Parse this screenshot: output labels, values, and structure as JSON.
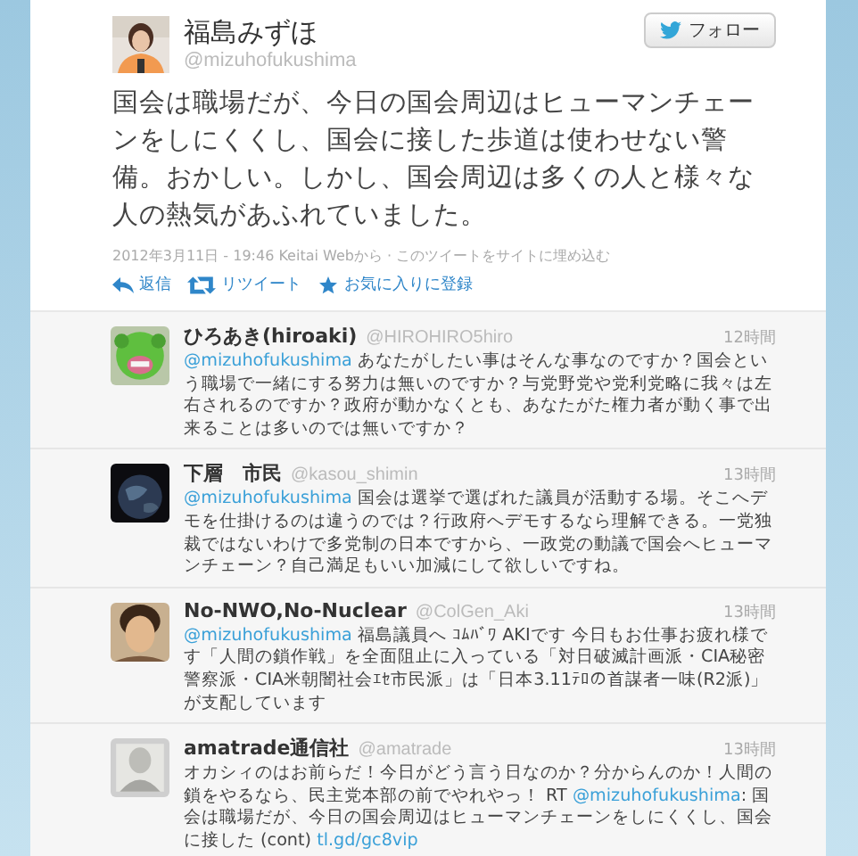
{
  "tweet": {
    "name": "福島みずほ",
    "handle": "@mizuhofukushima",
    "follow_button": "フォロー",
    "text": "国会は職場だが、今日の国会周辺はヒューマンチェーンをしにくくし、国会に接した歩道は使わせない警備。おかしい。しかし、国会周辺は多くの人と様々な人の熱気があふれていました。",
    "meta": "2012年3月11日 - 19:46 Keitai Webから · このツイートをサイトに埋め込む",
    "actions": [
      {
        "kind": "reply",
        "label": "返信"
      },
      {
        "kind": "retweet",
        "label": "リツイート"
      },
      {
        "kind": "favorite",
        "label": "お気に入りに登録"
      }
    ]
  },
  "replies": [
    {
      "name": "ひろあき(hiroaki)",
      "handle": "@HIROHIRO5hiro",
      "time": "12時間",
      "parts": [
        {
          "kind": "link",
          "text": "@mizuhofukushima"
        },
        {
          "kind": "text",
          "text": " あなたがしたい事はそんな事なのですか？国会という職場で一緒にする努力は無いのですか？与党野党や党利党略に我々は左右されるのですか？政府が動かなくとも、あなたがた権力者が動く事で出来ることは多いのでは無いですか？"
        }
      ]
    },
    {
      "name": "下層　市民",
      "handle": "@kasou_shimin",
      "time": "13時間",
      "parts": [
        {
          "kind": "link",
          "text": "@mizuhofukushima"
        },
        {
          "kind": "text",
          "text": " 国会は選挙で選ばれた議員が活動する場。そこへデモを仕掛けるのは違うのでは？行政府へデモするなら理解できる。一党独裁ではないわけで多党制の日本ですから、一政党の動議で国会へヒューマンチェーン？自己満足もいい加減にして欲しいですね。"
        }
      ]
    },
    {
      "name": "No-NWO,No-Nuclear",
      "handle": "@ColGen_Aki",
      "time": "13時間",
      "parts": [
        {
          "kind": "link",
          "text": "@mizuhofukushima"
        },
        {
          "kind": "text",
          "text": " 福島議員へ ｺﾑﾊﾞﾜ AKIです 今日もお仕事お疲れ様です「人間の鎖作戦」を全面阻止に入っている「対日破滅計画派・CIA秘密警察派・CIA米朝闇社会ｴｾ市民派」は「日本3.11ﾃﾛの首謀者一味(R2派)」が支配しています"
        }
      ]
    },
    {
      "name": "amatrade通信社",
      "handle": "@amatrade",
      "time": "13時間",
      "parts": [
        {
          "kind": "text",
          "text": "オカシィのはお前らだ！今日がどう言う日なのか？分からんのか！人間の鎖をやるなら、民主党本部の前でやれやっ！ RT "
        },
        {
          "kind": "link",
          "text": "@mizuhofukushima"
        },
        {
          "kind": "text",
          "text": ": 国会は職場だが、今日の国会周辺はヒューマンチェーンをしにくくし、国会に接した (cont) "
        },
        {
          "kind": "link",
          "text": "tl.gd/gc8vip"
        }
      ]
    }
  ]
}
